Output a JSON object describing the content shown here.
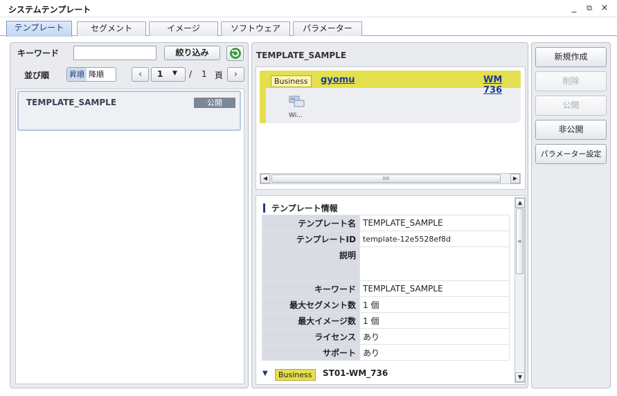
{
  "window": {
    "title": "システムテンプレート",
    "minimize": "_",
    "restore": "⧉",
    "close": "×"
  },
  "tabs": [
    {
      "label": "テンプレート",
      "active": true
    },
    {
      "label": "セグメント",
      "active": false
    },
    {
      "label": "イメージ",
      "active": false
    },
    {
      "label": "ソフトウェア",
      "active": false
    },
    {
      "label": "パラメーター",
      "active": false
    }
  ],
  "left": {
    "keyword_label": "キーワード",
    "keyword_value": "",
    "filter_button": "絞り込み",
    "sort_label": "並び順",
    "sort_asc": "昇順",
    "sort_desc": "降順",
    "page_current": "1",
    "page_sep": "/",
    "page_total": "1",
    "page_unit": "頁",
    "items": [
      {
        "name": "TEMPLATE_SAMPLE",
        "status": "公開"
      }
    ]
  },
  "center": {
    "title": "TEMPLATE_SAMPLE",
    "segment": {
      "tag": "Business",
      "name": "gyomu",
      "link": "WM 736",
      "image_caption": "Wi..."
    },
    "info_heading": "テンプレート情報",
    "rows": [
      {
        "k": "テンプレート名",
        "v": "TEMPLATE_SAMPLE"
      },
      {
        "k": "テンプレートID",
        "v": "template-12e5528ef8d"
      },
      {
        "k": "説明",
        "v": ""
      },
      {
        "k": "キーワード",
        "v": "TEMPLATE_SAMPLE"
      },
      {
        "k": "最大セグメント数",
        "v": "1 個"
      },
      {
        "k": "最大イメージ数",
        "v": "1 個"
      },
      {
        "k": "ライセンス",
        "v": "あり"
      },
      {
        "k": "サポート",
        "v": "あり"
      }
    ],
    "segment_section": {
      "tag": "Business",
      "name": "ST01-WM_736"
    }
  },
  "actions": {
    "new": "新規作成",
    "delete": "削除",
    "publish": "公開",
    "unpublish": "非公開",
    "params": "パラメーター設定"
  },
  "colors": {
    "accent": "#1d3a9b",
    "segment_bar": "#e4df4e",
    "badge_bg": "#fff6b3",
    "published_badge": "#7c8797"
  }
}
